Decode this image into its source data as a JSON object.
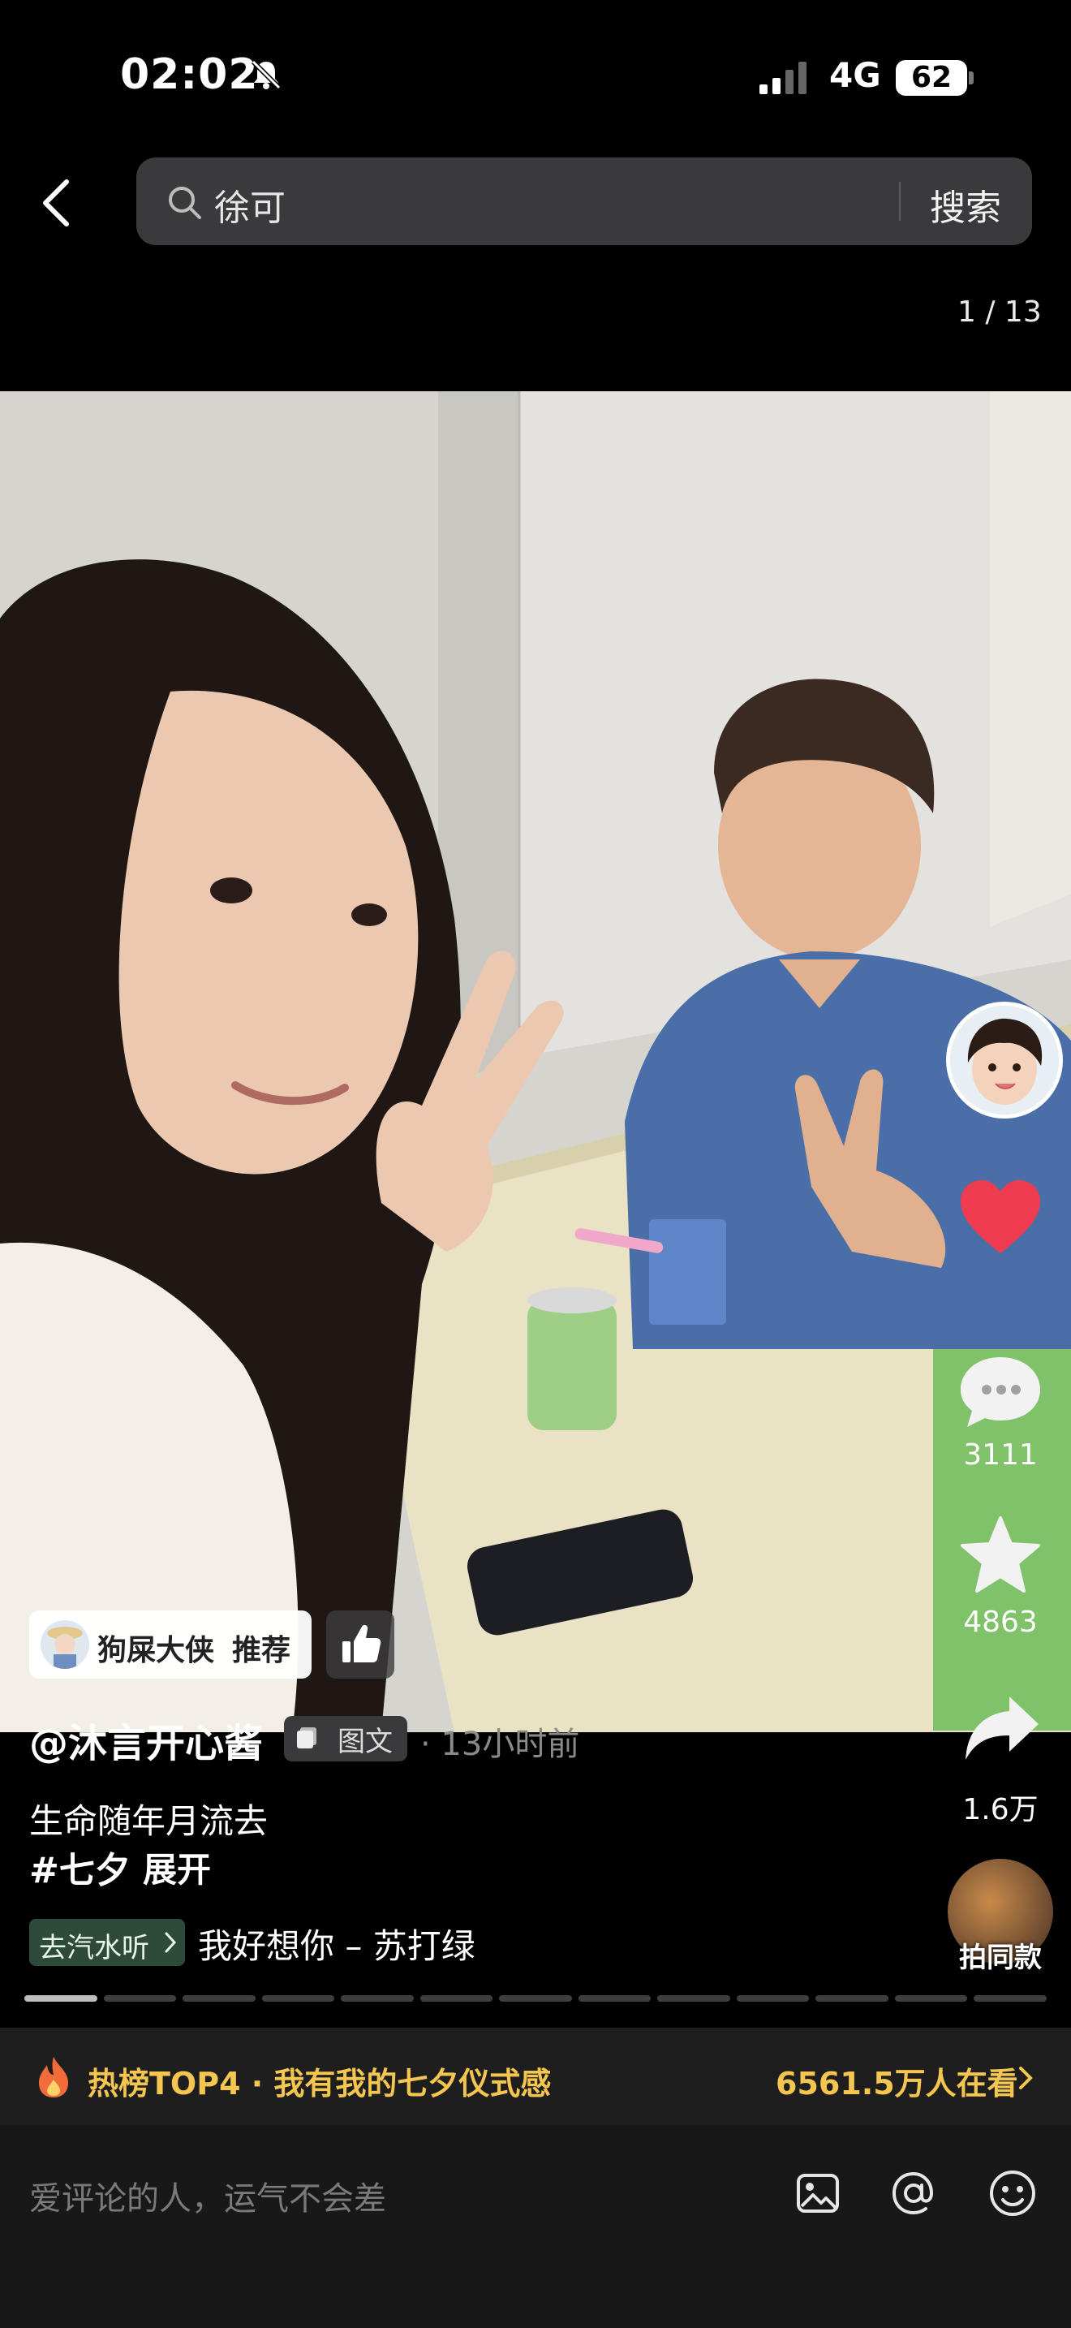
{
  "status_bar": {
    "time": "02:02",
    "network": "4G",
    "battery": "62"
  },
  "header": {
    "search_query": "徐可",
    "search_button": "搜索",
    "page_counter": "1 / 13"
  },
  "rail": {
    "comments": "3111",
    "favorites": "4863",
    "shares": "1.6万",
    "same_style": "拍同款"
  },
  "recommend": {
    "user": "狗屎大侠",
    "tag": "推荐"
  },
  "post": {
    "author": "@沐言开心酱",
    "type": "图文",
    "time": "· 13小时前",
    "description": "生命随年月流去",
    "hashtag": "#七夕",
    "expand": "展开"
  },
  "music": {
    "button": "去汽水听",
    "song": "我好想你 – 苏打绿"
  },
  "progress": {
    "total": 13,
    "current": 1
  },
  "hot": {
    "text": "热榜TOP4 · 我有我的七夕仪式感",
    "count": "6561.5万人在看"
  },
  "comment": {
    "placeholder": "爱评论的人，运气不会差"
  },
  "colors": {
    "like": "#ee3b4f",
    "hot": "#f4c64f",
    "music_bg": "#2d4a3a"
  }
}
